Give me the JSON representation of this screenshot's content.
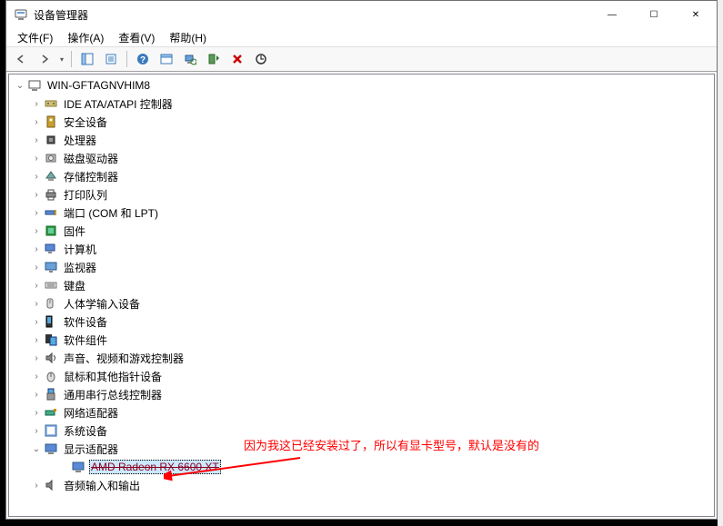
{
  "window": {
    "title": "设备管理器",
    "controls": {
      "min": "—",
      "max": "☐",
      "close": "✕"
    }
  },
  "menubar": {
    "file": "文件(F)",
    "action": "操作(A)",
    "view": "查看(V)",
    "help": "帮助(H)"
  },
  "toolbar": {
    "back": "back-icon",
    "forward": "forward-icon",
    "showhide": "showhide-icon",
    "properties": "properties-icon",
    "help": "help-icon",
    "details": "details-icon",
    "scan": "scan-icon",
    "addlegacy": "addlegacy-icon",
    "uninstall": "uninstall-icon",
    "update": "update-icon"
  },
  "tree": {
    "root": {
      "label": "WIN-GFTAGNVHIM8",
      "expanded": true
    },
    "children": [
      {
        "label": "IDE ATA/ATAPI 控制器",
        "icon": "ide"
      },
      {
        "label": "安全设备",
        "icon": "security"
      },
      {
        "label": "处理器",
        "icon": "cpu"
      },
      {
        "label": "磁盘驱动器",
        "icon": "disk"
      },
      {
        "label": "存储控制器",
        "icon": "storage"
      },
      {
        "label": "打印队列",
        "icon": "printer"
      },
      {
        "label": "端口 (COM 和 LPT)",
        "icon": "port"
      },
      {
        "label": "固件",
        "icon": "firmware"
      },
      {
        "label": "计算机",
        "icon": "computer"
      },
      {
        "label": "监视器",
        "icon": "monitor"
      },
      {
        "label": "键盘",
        "icon": "keyboard"
      },
      {
        "label": "人体学输入设备",
        "icon": "hid"
      },
      {
        "label": "软件设备",
        "icon": "softdevice"
      },
      {
        "label": "软件组件",
        "icon": "softcomp"
      },
      {
        "label": "声音、视频和游戏控制器",
        "icon": "sound"
      },
      {
        "label": "鼠标和其他指针设备",
        "icon": "mouse"
      },
      {
        "label": "通用串行总线控制器",
        "icon": "usb"
      },
      {
        "label": "网络适配器",
        "icon": "network"
      },
      {
        "label": "系统设备",
        "icon": "system"
      },
      {
        "label": "显示适配器",
        "icon": "display",
        "expanded": true,
        "children": [
          {
            "label": "AMD Radeon RX 6600 XT",
            "selected": true
          }
        ]
      },
      {
        "label": "音频输入和输出",
        "icon": "audio"
      }
    ]
  },
  "annotation": {
    "text": "因为我这已经安装过了，所以有显卡型号，默认是没有的"
  }
}
